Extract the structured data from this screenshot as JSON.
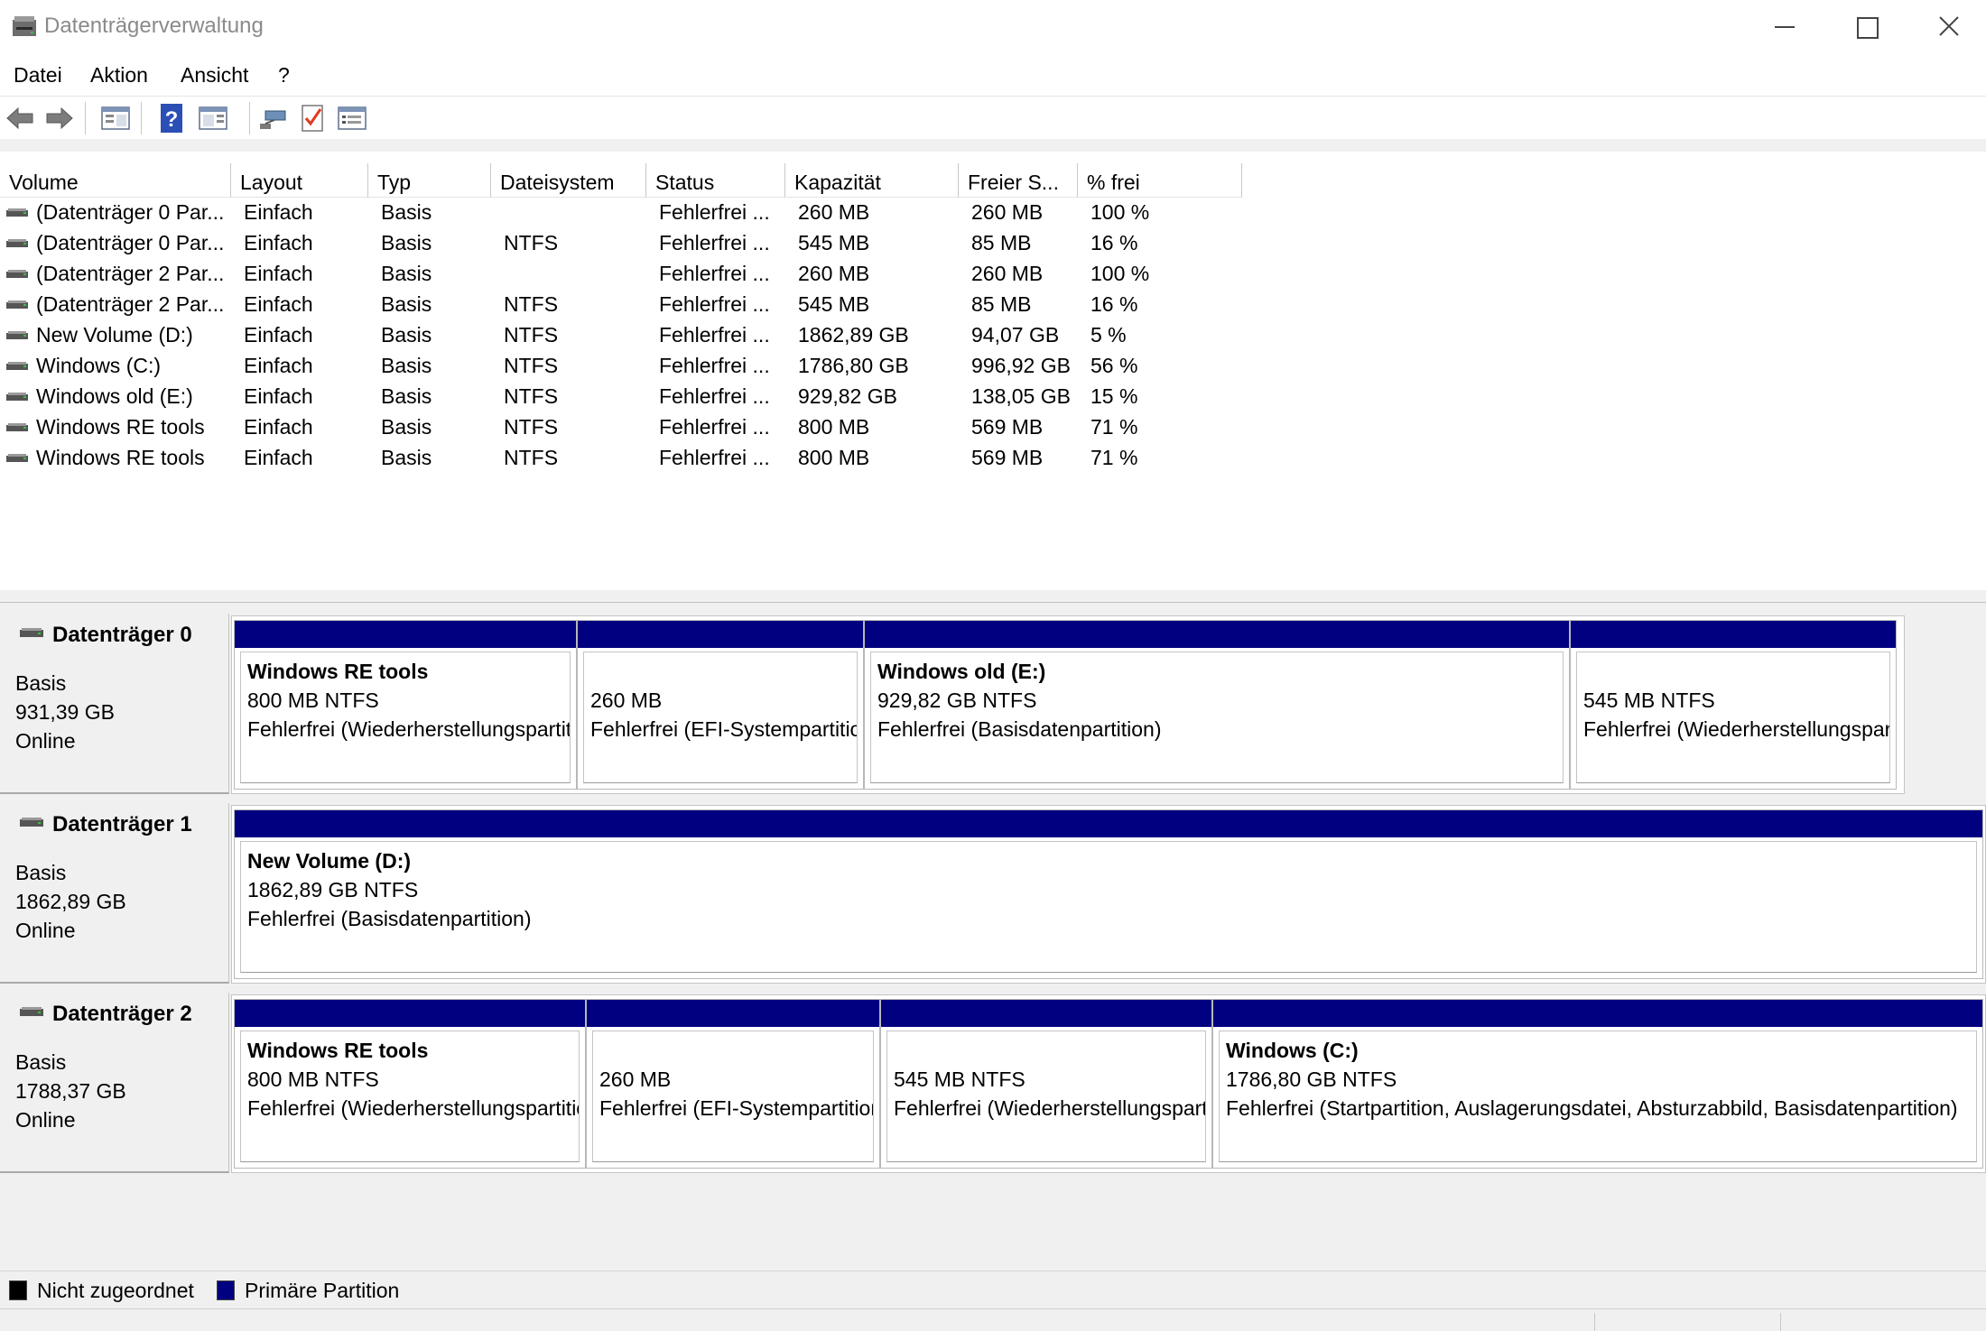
{
  "window": {
    "title": "Datenträgerverwaltung"
  },
  "menu": {
    "items": [
      "Datei",
      "Aktion",
      "Ansicht",
      "?"
    ]
  },
  "toolbar": {
    "icons": [
      "back-arrow-icon",
      "forward-arrow-icon",
      "console-tree-icon",
      "help-icon",
      "action-pane-icon",
      "connect-icon",
      "properties-checklist-icon",
      "view-list-icon"
    ]
  },
  "volume_list": {
    "columns": [
      "Volume",
      "Layout",
      "Typ",
      "Dateisystem",
      "Status",
      "Kapazität",
      "Freier S...",
      "% frei"
    ],
    "rows": [
      {
        "volume": "(Datenträger 0 Par...",
        "layout": "Einfach",
        "typ": "Basis",
        "dateisystem": "",
        "status": "Fehlerfrei ...",
        "kapazitaet": "260 MB",
        "frei": "260 MB",
        "prozent": "100 %"
      },
      {
        "volume": "(Datenträger 0 Par...",
        "layout": "Einfach",
        "typ": "Basis",
        "dateisystem": "NTFS",
        "status": "Fehlerfrei ...",
        "kapazitaet": "545 MB",
        "frei": "85 MB",
        "prozent": "16 %"
      },
      {
        "volume": "(Datenträger 2 Par...",
        "layout": "Einfach",
        "typ": "Basis",
        "dateisystem": "",
        "status": "Fehlerfrei ...",
        "kapazitaet": "260 MB",
        "frei": "260 MB",
        "prozent": "100 %"
      },
      {
        "volume": "(Datenträger 2 Par...",
        "layout": "Einfach",
        "typ": "Basis",
        "dateisystem": "NTFS",
        "status": "Fehlerfrei ...",
        "kapazitaet": "545 MB",
        "frei": "85 MB",
        "prozent": "16 %"
      },
      {
        "volume": "New Volume (D:)",
        "layout": "Einfach",
        "typ": "Basis",
        "dateisystem": "NTFS",
        "status": "Fehlerfrei ...",
        "kapazitaet": "1862,89 GB",
        "frei": "94,07 GB",
        "prozent": "5 %"
      },
      {
        "volume": "Windows (C:)",
        "layout": "Einfach",
        "typ": "Basis",
        "dateisystem": "NTFS",
        "status": "Fehlerfrei ...",
        "kapazitaet": "1786,80 GB",
        "frei": "996,92 GB",
        "prozent": "56 %"
      },
      {
        "volume": "Windows old (E:)",
        "layout": "Einfach",
        "typ": "Basis",
        "dateisystem": "NTFS",
        "status": "Fehlerfrei ...",
        "kapazitaet": "929,82 GB",
        "frei": "138,05 GB",
        "prozent": "15 %"
      },
      {
        "volume": "Windows RE tools",
        "layout": "Einfach",
        "typ": "Basis",
        "dateisystem": "NTFS",
        "status": "Fehlerfrei ...",
        "kapazitaet": "800 MB",
        "frei": "569 MB",
        "prozent": "71 %"
      },
      {
        "volume": "Windows RE tools",
        "layout": "Einfach",
        "typ": "Basis",
        "dateisystem": "NTFS",
        "status": "Fehlerfrei ...",
        "kapazitaet": "800 MB",
        "frei": "569 MB",
        "prozent": "71 %"
      }
    ]
  },
  "disks": [
    {
      "name": "Datenträger 0",
      "type": "Basis",
      "size": "931,39 GB",
      "state": "Online",
      "partitions": [
        {
          "name": "Windows RE tools",
          "size": "800 MB NTFS",
          "status": "Fehlerfrei (Wiederherstellungspartition)"
        },
        {
          "name": "",
          "size": "260 MB",
          "status": "Fehlerfrei (EFI-Systempartition)"
        },
        {
          "name": "Windows old  (E:)",
          "size": "929,82 GB NTFS",
          "status": "Fehlerfrei (Basisdatenpartition)"
        },
        {
          "name": "",
          "size": "545 MB NTFS",
          "status": "Fehlerfrei (Wiederherstellungspartition)"
        }
      ]
    },
    {
      "name": "Datenträger 1",
      "type": "Basis",
      "size": "1862,89 GB",
      "state": "Online",
      "partitions": [
        {
          "name": "New Volume  (D:)",
          "size": "1862,89 GB NTFS",
          "status": "Fehlerfrei (Basisdatenpartition)"
        }
      ]
    },
    {
      "name": "Datenträger 2",
      "type": "Basis",
      "size": "1788,37 GB",
      "state": "Online",
      "partitions": [
        {
          "name": "Windows RE tools",
          "size": "800 MB NTFS",
          "status": "Fehlerfrei (Wiederherstellungspartition)"
        },
        {
          "name": "",
          "size": "260 MB",
          "status": "Fehlerfrei (EFI-Systempartition)"
        },
        {
          "name": "",
          "size": "545 MB NTFS",
          "status": "Fehlerfrei (Wiederherstellungspartition)"
        },
        {
          "name": "Windows  (C:)",
          "size": "1786,80 GB NTFS",
          "status": "Fehlerfrei (Startpartition, Auslagerungsdatei, Absturzabbild, Basisdatenpartition)"
        }
      ]
    }
  ],
  "legend": {
    "items": [
      {
        "label": "Nicht zugeordnet",
        "color": "#000000"
      },
      {
        "label": "Primäre Partition",
        "color": "#000080"
      }
    ]
  },
  "colors": {
    "partition_bar": "#000080",
    "title_text": "#8a8a8a"
  }
}
